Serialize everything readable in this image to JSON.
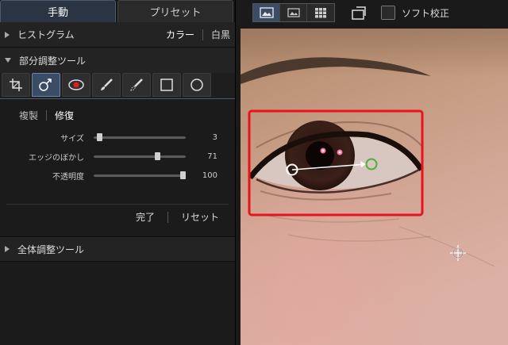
{
  "tabs": {
    "manual": "手動",
    "preset": "プリセット"
  },
  "histogram": {
    "title": "ヒストグラム",
    "color": "カラー",
    "mono": "白黒"
  },
  "partial_tools": {
    "title": "部分調整ツール"
  },
  "tools": [
    "crop-icon",
    "healing-brush-icon",
    "red-eye-icon",
    "brush-icon",
    "eraser-brush-icon",
    "rectangle-icon",
    "circle-icon"
  ],
  "modes": {
    "clone": "複製",
    "repair": "修復"
  },
  "sliders": {
    "size": {
      "label": "サイズ",
      "value": "3",
      "level": 0.04
    },
    "feather": {
      "label": "エッジのぼかし",
      "value": "71",
      "level": 0.71
    },
    "opacity": {
      "label": "不透明度",
      "value": "100",
      "level": 1.0
    }
  },
  "actions": {
    "done": "完了",
    "reset": "リセット"
  },
  "global_tools": {
    "title": "全体調整ツール"
  },
  "toolbar": {
    "soft_proof": "ソフト校正"
  },
  "colors": {
    "accent": "#3b4d66",
    "selection_box": "#e8131d",
    "source_circle": "#ffffff",
    "target_circle": "#4caf3a"
  }
}
